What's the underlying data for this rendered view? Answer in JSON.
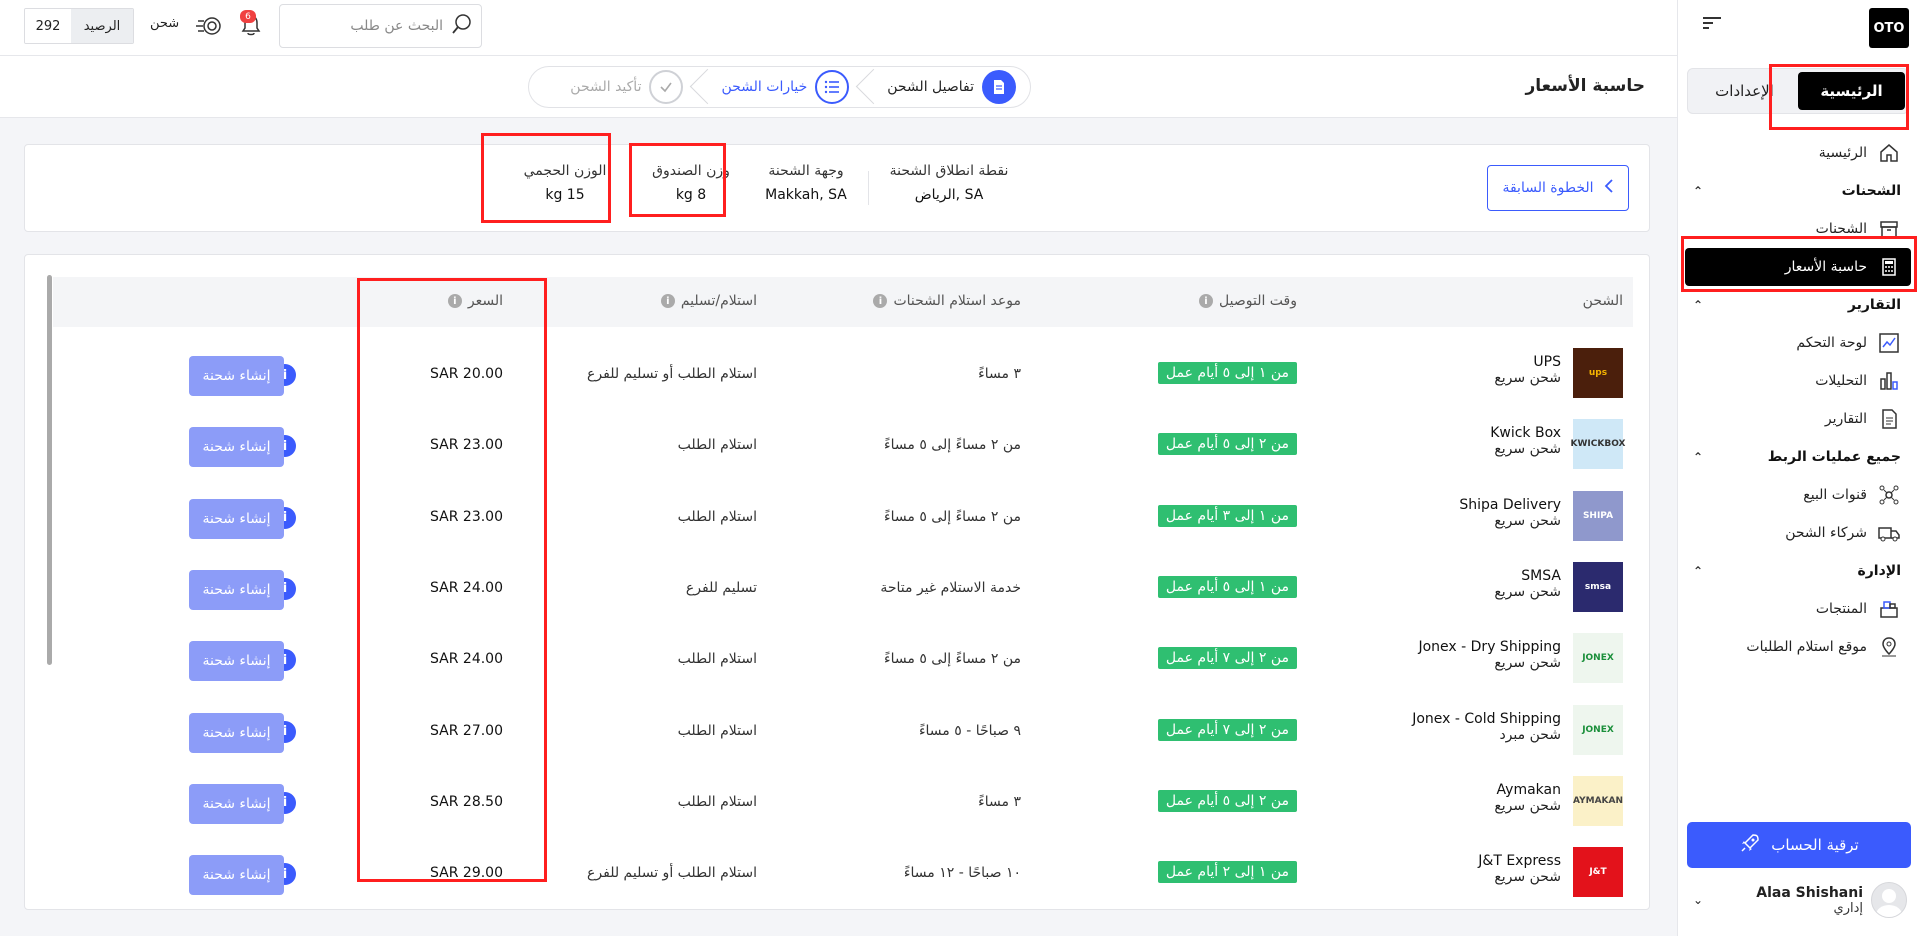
{
  "sidebar": {
    "logo": "OTO",
    "tabs": [
      {
        "label": "الرئيسية"
      },
      {
        "label": "الإعدادات"
      }
    ],
    "items": [
      {
        "label": "الرئيسية"
      },
      {
        "label": "الشحنات"
      },
      {
        "label": "الشحنات"
      },
      {
        "label": "حاسبة الأسعار"
      },
      {
        "label": "التقارير"
      },
      {
        "label": "لوحة التحكم"
      },
      {
        "label": "التحليلات"
      },
      {
        "label": "التقارير"
      },
      {
        "label": "جميع عمليات الربط"
      },
      {
        "label": "قنوات البيع"
      },
      {
        "label": "شركاء الشحن"
      },
      {
        "label": "الإدارة"
      },
      {
        "label": "المنتجات"
      },
      {
        "label": "موقع استلام الطلبات"
      }
    ],
    "upgrade_label": "ترقية الحساب",
    "user": {
      "name": "Alaa Shishani",
      "role": "إداري"
    }
  },
  "topbar": {
    "balance_value": "292",
    "balance_label": "الرصيد",
    "ship_label": "شحن",
    "notif_count": "6",
    "search_placeholder": "البحث عن طلب"
  },
  "header": {
    "title": "حاسبة الأسعار",
    "steps": [
      {
        "label": "تفاصيل الشحن",
        "state": "done"
      },
      {
        "label": "خيارات الشحن",
        "state": "current"
      },
      {
        "label": "تأكيد الشحن",
        "state": "pending"
      }
    ]
  },
  "summary": {
    "prev_label": "الخطوة السابقة",
    "origin_label": "نقطة انطلاق الشحنة",
    "origin_value": "الرياض, SA",
    "dest_label": "وجهة الشحنة",
    "dest_value": "Makkah, SA",
    "box_weight_label": "وزن الصندوق",
    "box_weight_value": "kg 8",
    "vol_weight_label": "الوزن الحجمي",
    "vol_weight_value": "kg 15"
  },
  "table": {
    "headers": {
      "carrier": "الشحن",
      "delivery_time": "وقت التوصيل",
      "pickup_time": "موعد استلام الشحنات",
      "method": "استلام/تسليم",
      "price": "السعر"
    },
    "create_label": "إنشاء شحنة",
    "rows": [
      {
        "name": "UPS",
        "type": "شحن سريع",
        "delivery": "من ١ إلى ٥ أيام عمل",
        "pickup": "٣ مساءً",
        "method": "استلام الطلب أو تسليم للفرع",
        "price": "SAR 20.00",
        "logo": "ups",
        "logo_bg": "#4b1f0c",
        "logo_fg": "#f5b400"
      },
      {
        "name": "Kwick Box",
        "type": "شحن سريع",
        "delivery": "من ٢ إلى ٥ أيام عمل",
        "pickup": "من ٢ مساءً إلى ٥ مساءً",
        "method": "استلام الطلب",
        "price": "SAR 23.00",
        "logo": "KWICKBOX",
        "logo_bg": "#cfe8f7",
        "logo_fg": "#333"
      },
      {
        "name": "Shipa Delivery",
        "type": "شحن سريع",
        "delivery": "من ١ إلى ٣ أيام عمل",
        "pickup": "من ٢ مساءً إلى ٥ مساءً",
        "method": "استلام الطلب",
        "price": "SAR 23.00",
        "logo": "SHIPA",
        "logo_bg": "#8f98cc",
        "logo_fg": "#fff"
      },
      {
        "name": "SMSA",
        "type": "شحن سريع",
        "delivery": "من ١ إلى ٥ أيام عمل",
        "pickup": "خدمة الاستلام غير متاحة",
        "method": "تسليم للفرع",
        "price": "SAR 24.00",
        "logo": "smsa",
        "logo_bg": "#2b2a6e",
        "logo_fg": "#fff"
      },
      {
        "name": "Jonex - Dry Shipping",
        "type": "شحن سريع",
        "delivery": "من ٢ إلى ٧ أيام عمل",
        "pickup": "من ٢ مساءً إلى ٥ مساءً",
        "method": "استلام الطلب",
        "price": "SAR 24.00",
        "logo": "JONEX",
        "logo_bg": "#eef6ee",
        "logo_fg": "#1a8f3a"
      },
      {
        "name": "Jonex - Cold Shipping",
        "type": "شحن مبرد",
        "delivery": "من ٢ إلى ٧ أيام عمل",
        "pickup": "٩ صباحًا - ٥ مساءً",
        "method": "استلام الطلب",
        "price": "SAR 27.00",
        "logo": "JONEX",
        "logo_bg": "#eef6ee",
        "logo_fg": "#1a8f3a"
      },
      {
        "name": "Aymakan",
        "type": "شحن سريع",
        "delivery": "من ٢ إلى ٥ أيام عمل",
        "pickup": "٣ مساءً",
        "method": "استلام الطلب",
        "price": "SAR 28.50",
        "logo": "AYMAKAN",
        "logo_bg": "#fbf1c8",
        "logo_fg": "#444"
      },
      {
        "name": "J&T Express",
        "type": "شحن سريع",
        "delivery": "من ١ إلى ٢ أيام عمل",
        "pickup": "١٠ صباحًا - ١٢ مساءً",
        "method": "استلام الطلب أو تسليم للفرع",
        "price": "SAR 29.00",
        "logo": "J&T",
        "logo_bg": "#e3121b",
        "logo_fg": "#fff"
      }
    ]
  },
  "colors": {
    "accent": "#3b5bfd",
    "success": "#2fbf71",
    "highlight": "#ff1f1f"
  }
}
